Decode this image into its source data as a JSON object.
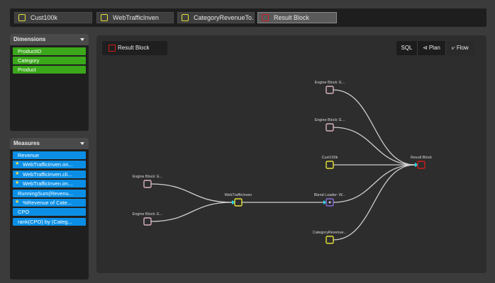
{
  "tabs": [
    {
      "label": "Cust100k",
      "color": "#e8e23a"
    },
    {
      "label": "WebTrafficInven",
      "color": "#e8e23a"
    },
    {
      "label": "CategoryRevenueTo...",
      "color": "#e8e23a"
    },
    {
      "label": "Result Block",
      "color": "#d21b1b",
      "active": true
    }
  ],
  "dimensions": {
    "title": "Dimensions",
    "items": [
      "ProductID",
      "Category",
      "Product"
    ]
  },
  "measures": {
    "title": "Measures",
    "items": [
      {
        "label": "Revenue",
        "starred": false
      },
      {
        "label": "WebTrafficInven.on...",
        "starred": true
      },
      {
        "label": "WebTrafficInven.cli...",
        "starred": true
      },
      {
        "label": "WebTrafficInven.im...",
        "starred": true
      },
      {
        "label": "RunningSum(Revenu...",
        "starred": false
      },
      {
        "label": "%Revenue of Cate...",
        "starred": true
      },
      {
        "label": "CPO",
        "starred": false
      },
      {
        "label": "rank(CPO) by (Categ...",
        "starred": false
      }
    ]
  },
  "canvas": {
    "title": "Result Block",
    "views": [
      {
        "label": "SQL",
        "icon": ""
      },
      {
        "label": "Plan",
        "icon": "plan-icon"
      },
      {
        "label": "Flow",
        "icon": "flow-icon"
      }
    ]
  },
  "colors": {
    "engine_block": "#d9b2c4",
    "source_block": "#e8e23a",
    "result_block": "#d21b1b",
    "blend_block": "#8a6cd9",
    "edge": "#d0d0d0",
    "arrow": "#2bd0e0"
  },
  "flow": {
    "nodes": [
      {
        "id": "eb1",
        "label": "Engine Block: E...",
        "kind": "engine"
      },
      {
        "id": "eb2",
        "label": "Engine Block: E...",
        "kind": "engine"
      },
      {
        "id": "cust",
        "label": "Cust100k",
        "kind": "source"
      },
      {
        "id": "eb3",
        "label": "Engine Block: E...",
        "kind": "engine"
      },
      {
        "id": "eb4",
        "label": "Engine Block: E...",
        "kind": "engine"
      },
      {
        "id": "web",
        "label": "WebTrafficInven",
        "kind": "source"
      },
      {
        "id": "blend",
        "label": "Blend Loader: W...",
        "kind": "blend"
      },
      {
        "id": "cat",
        "label": "CategoryRevenue...",
        "kind": "source"
      },
      {
        "id": "result",
        "label": "Result Block",
        "kind": "result"
      }
    ],
    "edges": [
      [
        "eb1",
        "result"
      ],
      [
        "eb2",
        "result"
      ],
      [
        "cust",
        "result"
      ],
      [
        "blend",
        "result"
      ],
      [
        "cat",
        "result"
      ],
      [
        "eb3",
        "web"
      ],
      [
        "eb4",
        "web"
      ],
      [
        "web",
        "blend"
      ]
    ]
  }
}
